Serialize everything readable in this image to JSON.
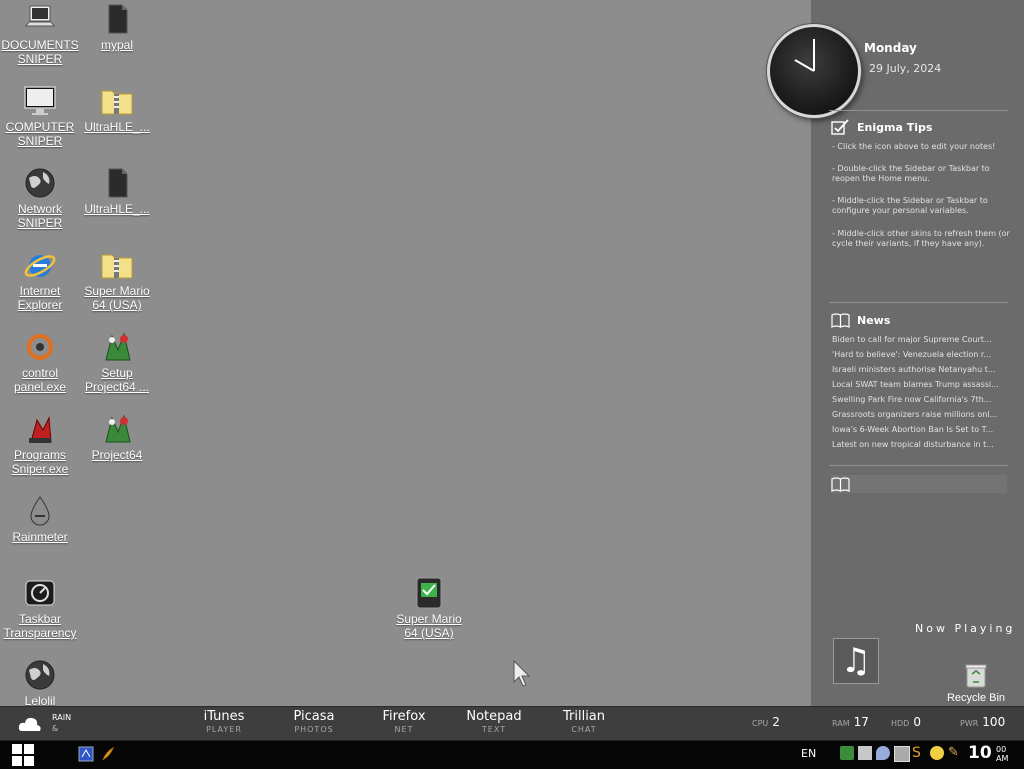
{
  "desktop": {
    "icons": [
      {
        "label": "DOCUMENTS\nSNIPER",
        "icon": "laptop-icon"
      },
      {
        "label": "mypal",
        "icon": "black-document-icon"
      },
      {
        "label": "COMPUTER\nSNIPER",
        "icon": "monitor-icon"
      },
      {
        "label": "UltraHLE_...",
        "icon": "zip-folder-icon"
      },
      {
        "label": "Network\nSNIPER",
        "icon": "globe-icon"
      },
      {
        "label": "UltraHLE_...",
        "icon": "black-document-icon"
      },
      {
        "label": "Internet\nExplorer",
        "icon": "internet-explorer-icon"
      },
      {
        "label": "Super Mario\n64 (USA)",
        "icon": "zip-folder-icon"
      },
      {
        "label": "control\npanel.exe",
        "icon": "control-panel-icon"
      },
      {
        "label": "Setup\nProject64 ...",
        "icon": "project64-icon"
      },
      {
        "label": "Programs\nSniper.exe",
        "icon": "programs-icon"
      },
      {
        "label": "Project64",
        "icon": "project64-icon"
      },
      {
        "label": "Rainmeter",
        "icon": "rainmeter-icon"
      },
      {
        "label": "Taskbar\nTransparency",
        "icon": "taskbar-transparency-icon"
      },
      {
        "label": "Lelolil",
        "icon": "globe-icon"
      },
      {
        "label": "Super Mario\n64 (USA)",
        "icon": "rom-file-icon"
      }
    ]
  },
  "sidebar": {
    "day": "Monday",
    "date": "29 July, 2024",
    "clock": {
      "hours": 10,
      "minutes": 0
    },
    "tips": {
      "title": "Enigma Tips",
      "items": [
        "- Click the icon above to edit your notes!",
        "- Double-click the Sidebar or Taskbar to reopen the Home menu.",
        "- Middle-click the Sidebar or Taskbar to configure your personal variables.",
        "- Middle-click other skins to refresh them (or cycle their variants, if they have any)."
      ]
    },
    "news": {
      "title": "News",
      "items": [
        "Biden to call for major Supreme Court...",
        "'Hard to believe': Venezuela election r...",
        "Israeli ministers authorise Netanyahu t...",
        "Local SWAT team blames Trump assassi...",
        "Swelling Park Fire now California's 7th...",
        "Grassroots organizers raise millions onl...",
        "Iowa's 6-Week Abortion Ban Is Set to T...",
        "Latest on new tropical disturbance in t..."
      ]
    },
    "now_playing": "Now Playing",
    "recycle_bin": "Recycle Bin"
  },
  "dock": {
    "rain_label": "RAIN",
    "rain_sub": "&",
    "items": [
      {
        "title": "iTunes",
        "sub": "PLAYER"
      },
      {
        "title": "Picasa",
        "sub": "PHOTOS"
      },
      {
        "title": "Firefox",
        "sub": "NET"
      },
      {
        "title": "Notepad",
        "sub": "TEXT"
      },
      {
        "title": "Trillian",
        "sub": "CHAT"
      }
    ],
    "stats": [
      {
        "label": "CPU",
        "value": "2"
      },
      {
        "label": "RAM",
        "value": "17"
      },
      {
        "label": "HDD",
        "value": "0"
      },
      {
        "label": "PWR",
        "value": "100"
      }
    ]
  },
  "taskbar": {
    "language": "EN",
    "time_hours": "10",
    "time_minutes": "00",
    "ampm": "AM"
  }
}
